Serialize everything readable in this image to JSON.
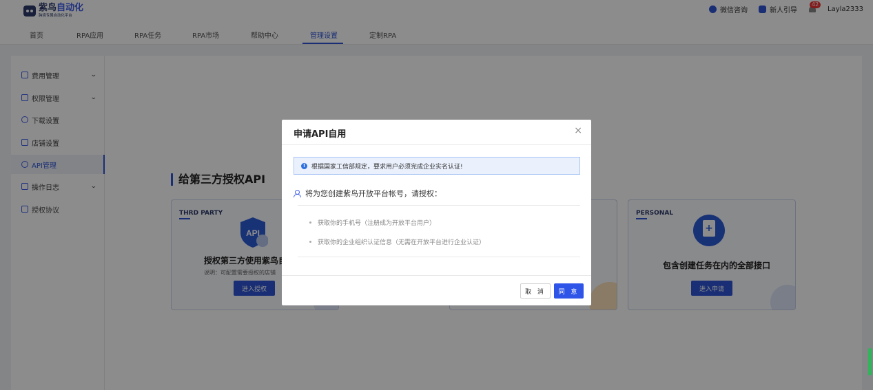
{
  "brand": {
    "title_a": "紫鸟",
    "title_b": "自动化",
    "subtitle": "跨境专属自动化平台"
  },
  "header": {
    "wechat": "微信咨询",
    "guide": "新人引导",
    "notification_count": "42",
    "username": "Layla2333"
  },
  "nav": {
    "items": [
      "首页",
      "RPA应用",
      "RPA任务",
      "RPA市场",
      "帮助中心",
      "管理设置",
      "定制RPA"
    ],
    "active_index": 5
  },
  "sidebar": {
    "items": [
      {
        "label": "费用管理",
        "icon": "fee-icon",
        "expandable": true
      },
      {
        "label": "权限管理",
        "icon": "shield-icon",
        "expandable": true
      },
      {
        "label": "下载设置",
        "icon": "download-icon",
        "expandable": false
      },
      {
        "label": "店铺设置",
        "icon": "store-icon",
        "expandable": false
      },
      {
        "label": "API管理",
        "icon": "cloud-icon",
        "expandable": false,
        "active": true
      },
      {
        "label": "操作日志",
        "icon": "log-icon",
        "expandable": true
      },
      {
        "label": "授权协议",
        "icon": "agreement-icon",
        "expandable": false
      }
    ]
  },
  "main": {
    "section_title": "给第三方授权API",
    "cards": [
      {
        "tag": "THRD PARTY",
        "title": "授权第三方使用紫鸟自动化",
        "desc": "说明：可配置需要授权的店铺",
        "button": "进入授权"
      },
      {
        "tag": "PERSONAL",
        "title": "包含创建任务在内的全部接口",
        "button": "进入申请"
      }
    ]
  },
  "modal": {
    "title": "申请API自用",
    "close": "×",
    "alert": "根据国家工信部规定，要求用户必须完成企业实名认证!",
    "auth_line": "将为您创建紫鸟开放平台帐号，请授权：",
    "permissions": [
      "获取你的手机号（注册成为开放平台用户）",
      "获取你的企业组织认证信息（无需在开放平台进行企业认证）"
    ],
    "cancel_label": "取 消",
    "ok_label": "同 意"
  },
  "colors": {
    "accent": "#2f55d4",
    "brand_dark": "#2d3a6b",
    "alert_bg": "#eaf1fd"
  }
}
